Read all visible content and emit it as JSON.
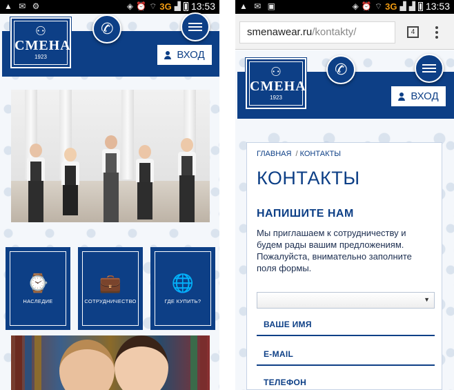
{
  "status_bar": {
    "left": {
      "time": "13:53",
      "network": "3G"
    },
    "right": {
      "time": "13:53",
      "network": "3G"
    }
  },
  "brand": {
    "logo_text": "СМЕНА",
    "logo_sub": "1923"
  },
  "header": {
    "login_label": "ВХОД"
  },
  "home": {
    "cards": [
      {
        "label": "НАСЛЕДИЕ",
        "icon": "compass-icon"
      },
      {
        "label": "СОТРУДНИЧЕСТВО",
        "icon": "briefcase-icon"
      },
      {
        "label": "ГДЕ КУПИТЬ?",
        "icon": "globe-icon"
      }
    ]
  },
  "browser": {
    "url_domain": "smenawear.ru",
    "url_path": "/kontakty/",
    "tab_count": "4"
  },
  "contacts": {
    "breadcrumb": {
      "home": "ГЛАВНАЯ",
      "current": "КОНТАКТЫ"
    },
    "title": "КОНТАКТЫ",
    "section_title": "НАПИШИТЕ НАМ",
    "intro": "Мы приглашаем к сотрудничеству и будем рады вашим предложениям. Пожалуйста, внимательно заполните поля формы.",
    "select_value": "",
    "fields": {
      "name": "ВАШЕ ИМЯ",
      "email": "E-MAIL",
      "phone": "ТЕЛЕФОН"
    }
  },
  "colors": {
    "brand_blue": "#0d3f86",
    "status_network": "#f39c12"
  }
}
